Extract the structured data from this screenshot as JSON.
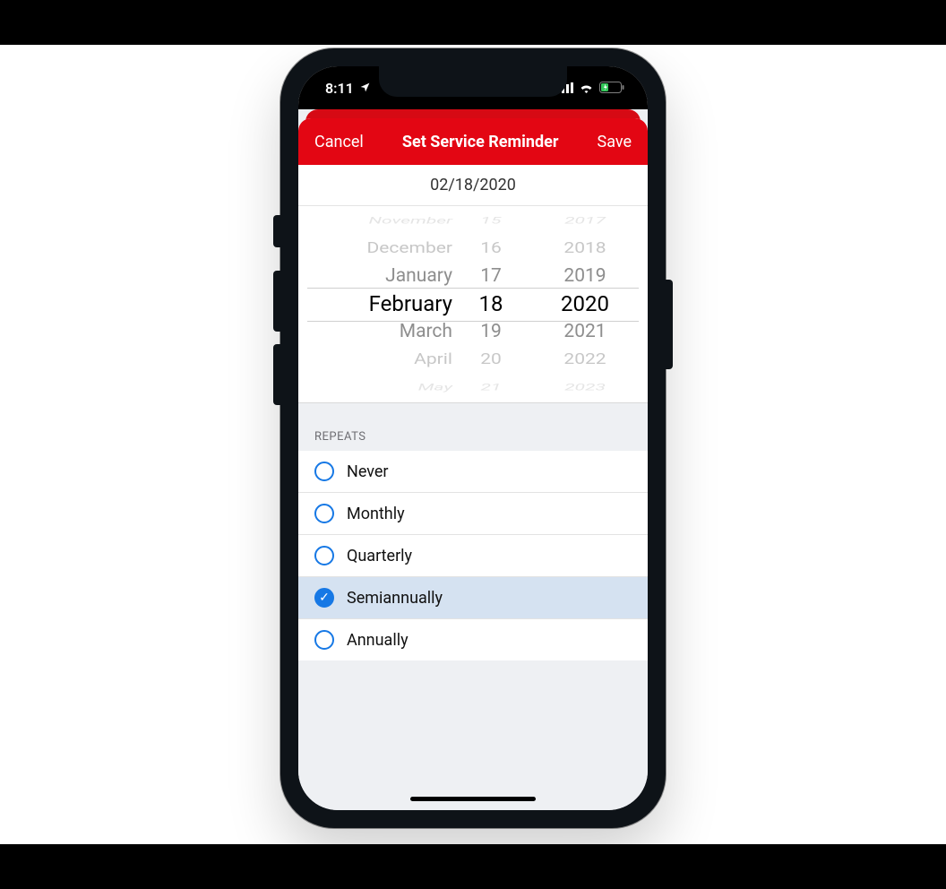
{
  "status": {
    "time": "8:11",
    "location_glyph": "➤"
  },
  "nav": {
    "cancel": "Cancel",
    "title": "Set Service Reminder",
    "save": "Save"
  },
  "date": {
    "display": "02/18/2020"
  },
  "picker": {
    "months": [
      "November",
      "December",
      "January",
      "February",
      "March",
      "April",
      "May"
    ],
    "days": [
      "15",
      "16",
      "17",
      "18",
      "19",
      "20",
      "21"
    ],
    "years": [
      "2017",
      "2018",
      "2019",
      "2020",
      "2021",
      "2022",
      "2023"
    ]
  },
  "repeats": {
    "header": "REPEATS",
    "options": [
      "Never",
      "Monthly",
      "Quarterly",
      "Semiannually",
      "Annually"
    ],
    "selected_index": 3
  }
}
